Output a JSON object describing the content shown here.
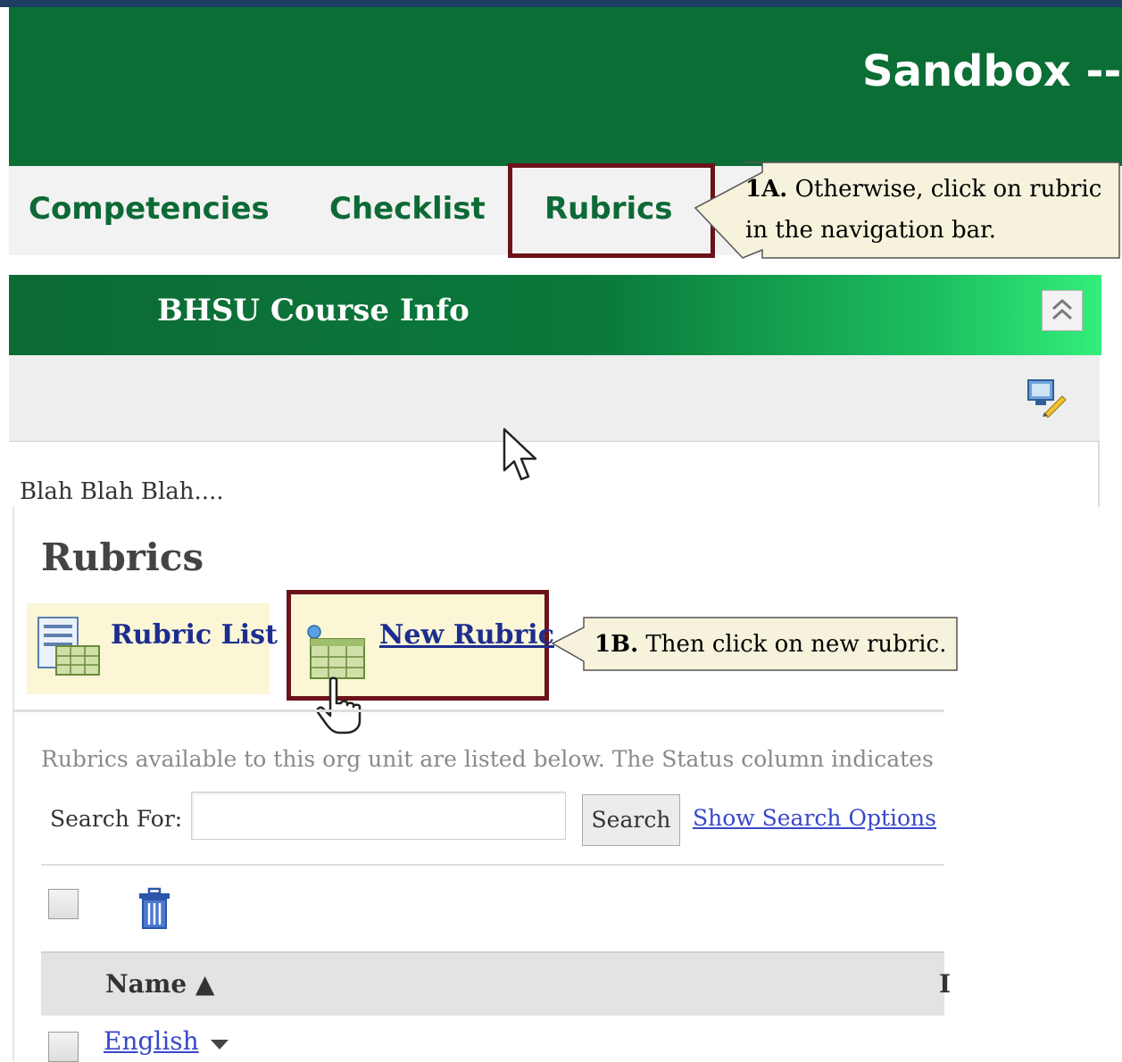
{
  "header": {
    "site_title": "Sandbox --"
  },
  "nav": {
    "items": [
      {
        "label": "Competencies"
      },
      {
        "label": "Checklist"
      },
      {
        "label": "Rubrics"
      }
    ]
  },
  "callouts": {
    "step_1a": {
      "prefix": "1A.",
      "line1": " Otherwise, click on rubric",
      "line2": "in the navigation bar."
    },
    "step_1b": {
      "prefix": "1B.",
      "text": " Then click on new rubric."
    }
  },
  "widget": {
    "title": "BHSU Course Info",
    "body_text": "Blah Blah Blah...."
  },
  "rubrics_page": {
    "title": "Rubrics",
    "tabs": {
      "rubric_list": "Rubric List",
      "new_rubric": "New Rubric"
    },
    "description": "Rubrics available to this org unit are listed below. The Status column indicates t",
    "search": {
      "label": "Search For:",
      "value": "",
      "button": "Search",
      "options_link": "Show Search Options"
    },
    "table": {
      "columns": [
        "Name ▲",
        "I"
      ],
      "rows": [
        {
          "name": "English"
        }
      ]
    }
  },
  "colors": {
    "brand_green": "#0a6e35",
    "highlight_border": "#6b1319",
    "link_blue": "#3848c8",
    "callout_bg": "#f6f2dc"
  },
  "icons": [
    "collapse-up-icon",
    "edit-widget-icon",
    "mouse-pointer-icon",
    "rubric-list-icon",
    "new-rubric-icon",
    "hand-cursor-icon",
    "trash-icon",
    "dropdown-arrow-icon"
  ]
}
